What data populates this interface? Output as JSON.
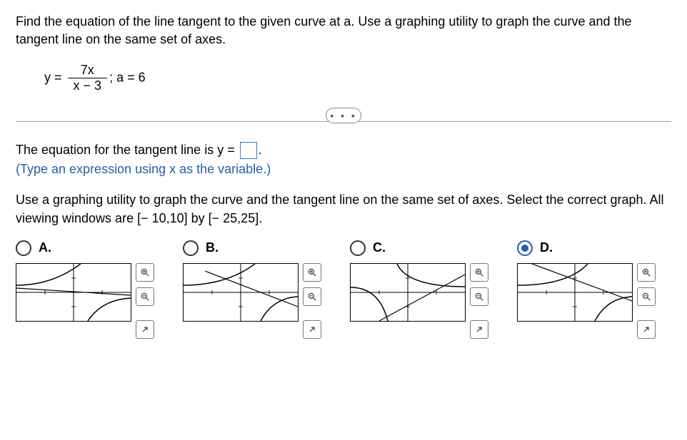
{
  "question": "Find the equation of the line tangent to the given curve at a. Use a graphing utility to graph the curve and the tangent line on the same set of axes.",
  "equation": {
    "lhs": "y =",
    "num": "7x",
    "den": "x − 3",
    "rhs": "; a = 6"
  },
  "prompt_prefix": "The equation for the tangent line is y =",
  "prompt_suffix": ".",
  "hint": "(Type an expression using x as the variable.)",
  "graph_instructions": "Use a graphing utility to graph the curve and the tangent line on the same set of axes. Select the correct graph. All viewing windows are [− 10,10] by [− 25,25].",
  "options": [
    {
      "label": "A.",
      "selected": false
    },
    {
      "label": "B.",
      "selected": false
    },
    {
      "label": "C.",
      "selected": false
    },
    {
      "label": "D.",
      "selected": true
    }
  ],
  "divider_dots": "• • •",
  "chart_data": {
    "type": "line",
    "note": "Four small thumbnails of y=7x/(x-3) with tangent at x=6, window [-10,10]×[-25,25]. Variations among options are minor orientation/tangent differences.",
    "xlim": [
      -10,
      10
    ],
    "ylim": [
      -25,
      25
    ],
    "series": [
      {
        "name": "curve",
        "expr": "7x/(x-3)"
      },
      {
        "name": "tangent_at_a",
        "a": 6
      }
    ]
  }
}
